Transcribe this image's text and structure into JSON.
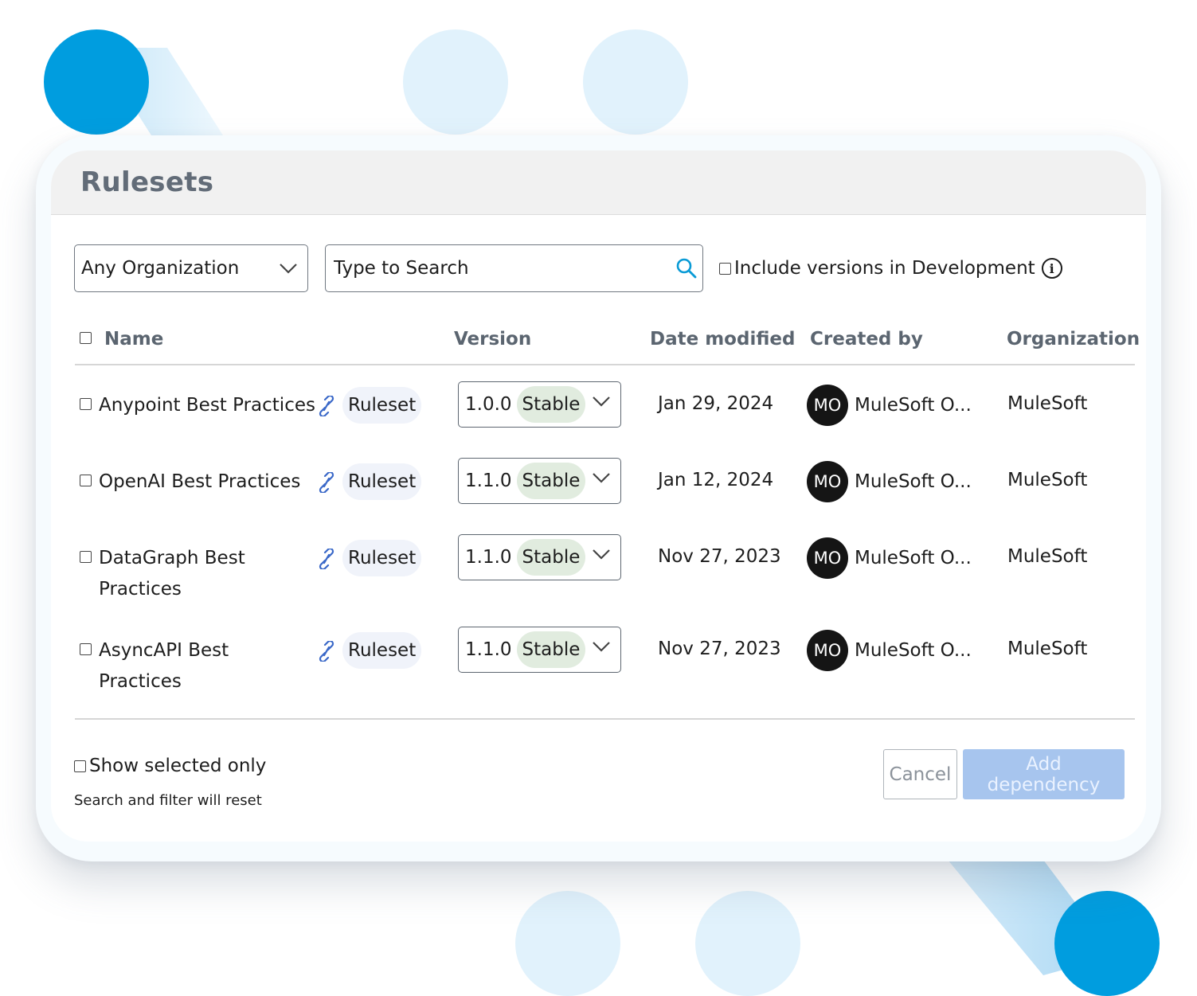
{
  "colors": {
    "accent": "#009ddf",
    "light_circle": "#e1f2fc",
    "stable_badge": "#e1ecdf",
    "primary_disabled": "#a7c5ee"
  },
  "panel": {
    "title": "Rulesets"
  },
  "filters": {
    "organization": "Any Organization",
    "search_placeholder": "Type to Search",
    "include_dev_label": "Include versions in Development"
  },
  "table": {
    "headers": {
      "name": "Name",
      "version": "Version",
      "date": "Date modified",
      "creator": "Created by",
      "org": "Organization"
    },
    "rows": [
      {
        "name": "Anypoint Best Practices",
        "tag": "Ruleset",
        "version": "1.0.0",
        "status": "Stable",
        "date": "Jan 29, 2024",
        "initials": "MO",
        "creator": "MuleSoft O...",
        "org": "MuleSoft"
      },
      {
        "name": "OpenAI Best Practices",
        "tag": "Ruleset",
        "version": "1.1.0",
        "status": "Stable",
        "date": "Jan 12, 2024",
        "initials": "MO",
        "creator": "MuleSoft O...",
        "org": "MuleSoft"
      },
      {
        "name": "DataGraph Best Practices",
        "tag": "Ruleset",
        "version": "1.1.0",
        "status": "Stable",
        "date": "Nov 27, 2023",
        "initials": "MO",
        "creator": "MuleSoft O...",
        "org": "MuleSoft"
      },
      {
        "name": "AsyncAPI Best Practices",
        "tag": "Ruleset",
        "version": "1.1.0",
        "status": "Stable",
        "date": "Nov 27, 2023",
        "initials": "MO",
        "creator": "MuleSoft O...",
        "org": "MuleSoft"
      }
    ]
  },
  "footer": {
    "show_selected_label": "Show selected only",
    "reset_note": "Search and filter will reset",
    "cancel_label": "Cancel",
    "add_label": "Add dependency"
  },
  "icons": [
    "chevron-down-icon",
    "search-icon",
    "info-icon",
    "link-icon",
    "checkbox"
  ]
}
